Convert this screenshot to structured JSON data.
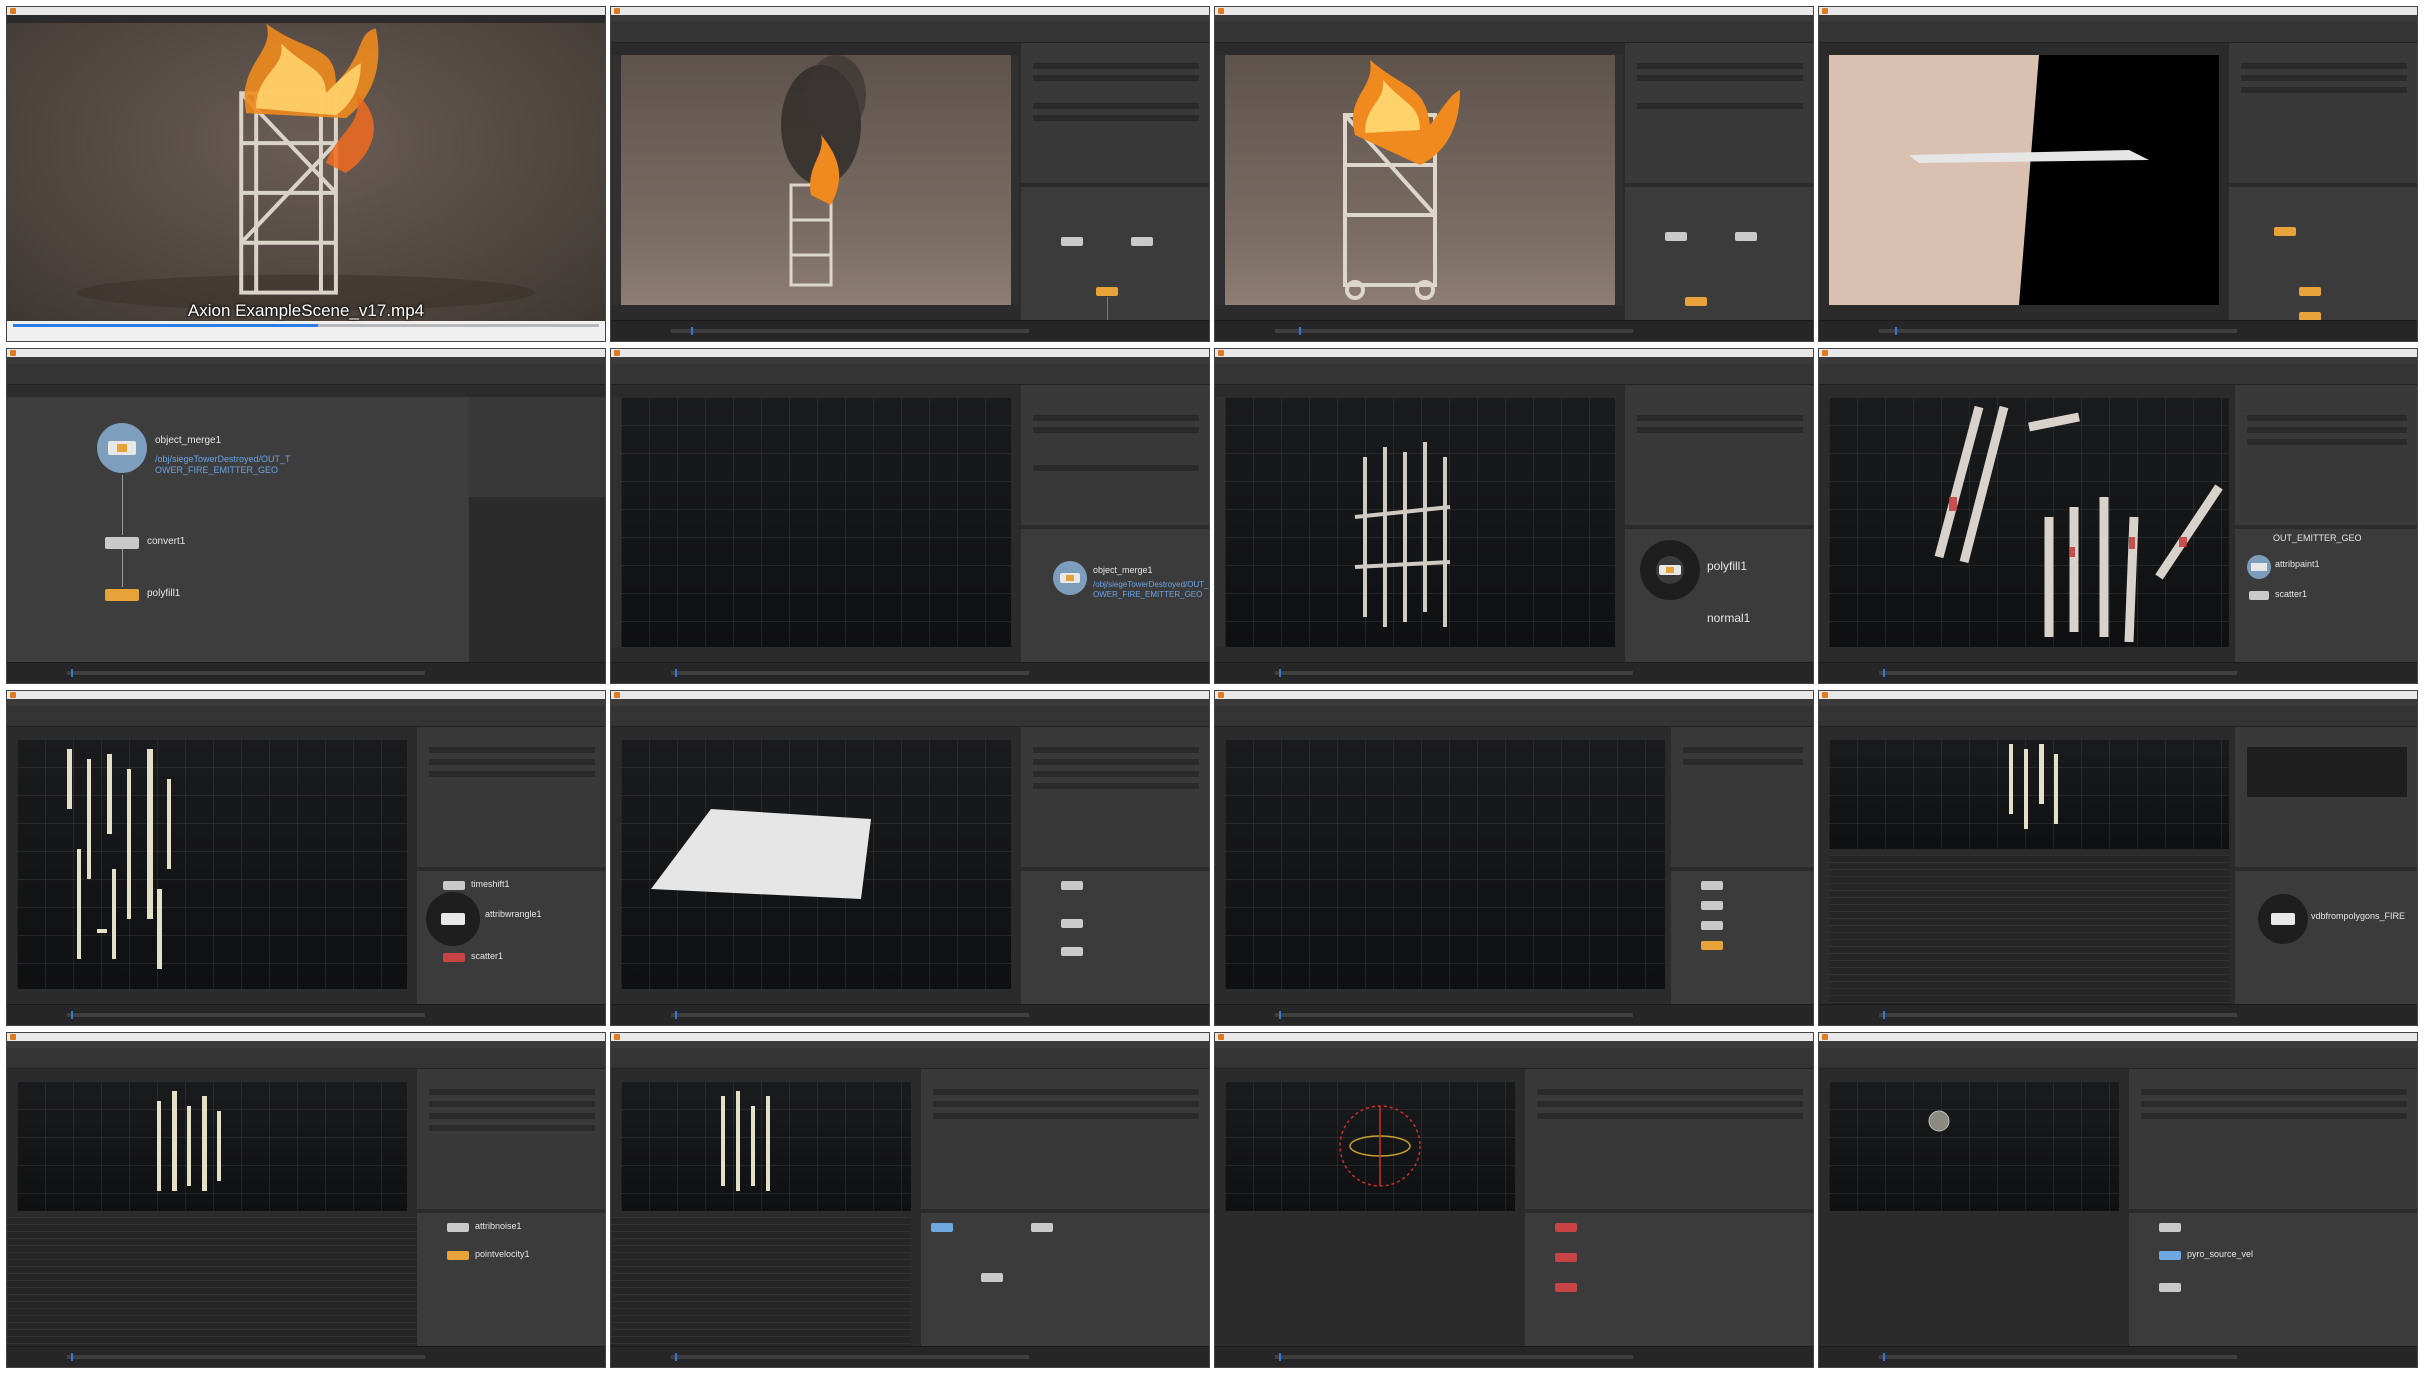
{
  "player": {
    "video_caption": "Axion ExampleScene_v17.mp4"
  },
  "tile5": {
    "node1_name": "object_merge1",
    "node1_path": "/obj/siegeTowerDestroyed/OUT_T",
    "node1_path2": "OWER_FIRE_EMITTER_GEO",
    "node2_name": "convert1",
    "node3_name": "polyfill1"
  },
  "tile6": {
    "node1_name": "object_merge1",
    "node1_path": "/obj/siegeTowerDestroyed/OUT_T",
    "node1_path2": "OWER_FIRE_EMITTER_GEO"
  },
  "tile7": {
    "node1_name": "polyfill1",
    "node2_name": "normal1"
  },
  "tile8": {
    "node1_name": "OUT_EMITTER_GEO",
    "node2_name": "attribpaint1",
    "node3_name": "scatter1"
  },
  "tile9": {
    "node1_name": "timeshift1",
    "node2_name": "attribwrangle1",
    "node3_name": "scatter1"
  },
  "tile12": {
    "node1_name": "vdbfrompolygons_FIRE"
  },
  "tile13": {
    "node1_name": "attribnoise1",
    "node2_name": "pointvelocity1"
  },
  "tile16": {
    "node1_name": "pyro_source_vel"
  },
  "colors": {
    "accent": "#2a7de1",
    "houdini_orange": "#e8a23a",
    "node_path_blue": "#6aa4e6"
  }
}
